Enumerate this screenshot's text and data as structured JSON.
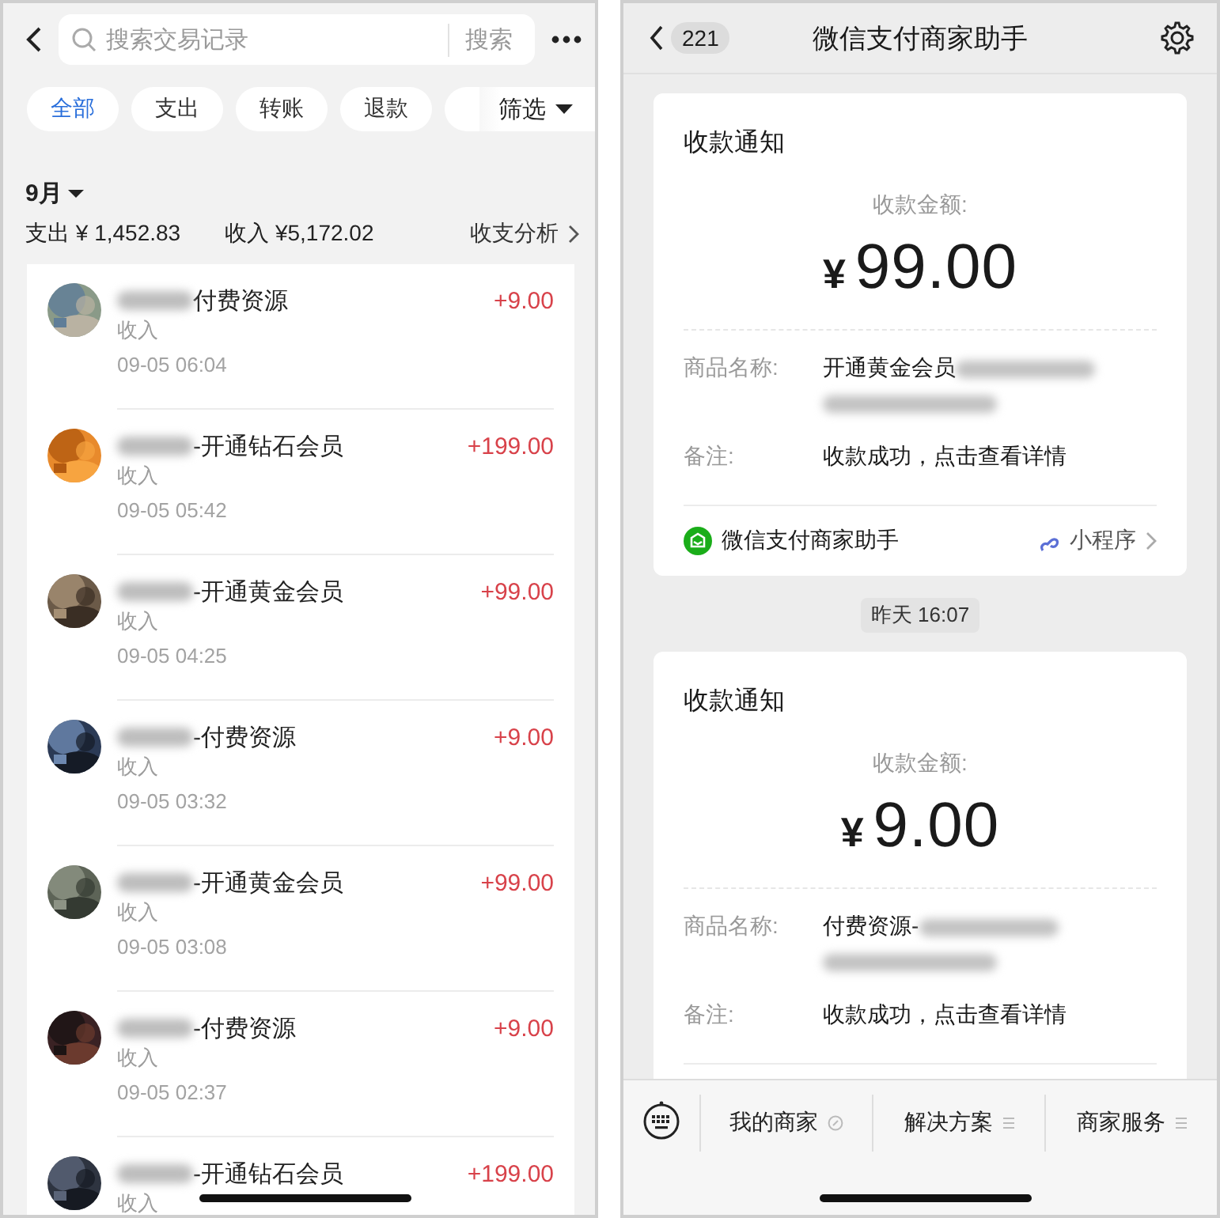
{
  "ledger": {
    "search": {
      "placeholder": "搜索交易记录",
      "button": "搜索"
    },
    "filters": [
      {
        "label": "全部",
        "selected": true
      },
      {
        "label": "支出",
        "selected": false
      },
      {
        "label": "转账",
        "selected": false
      },
      {
        "label": "退款",
        "selected": false
      }
    ],
    "filter_button": "筛选",
    "month": "9月",
    "expense": "支出 ¥ 1,452.83",
    "income": "收入 ¥5,172.02",
    "analysis": "收支分析",
    "transactions": [
      {
        "title": "付费资源",
        "redacted": true,
        "amount": "+9.00",
        "type": "收入",
        "time": "09-05 06:04"
      },
      {
        "title": "-开通钻石会员",
        "redacted": true,
        "amount": "+199.00",
        "type": "收入",
        "time": "09-05 05:42"
      },
      {
        "title": "-开通黄金会员",
        "redacted": true,
        "amount": "+99.00",
        "type": "收入",
        "time": "09-05 04:25"
      },
      {
        "title": "-付费资源",
        "redacted": true,
        "amount": "+9.00",
        "type": "收入",
        "time": "09-05 03:32"
      },
      {
        "title": "-开通黄金会员",
        "redacted": true,
        "amount": "+99.00",
        "type": "收入",
        "time": "09-05 03:08"
      },
      {
        "title": "-付费资源",
        "redacted": true,
        "amount": "+9.00",
        "type": "收入",
        "time": "09-05 02:37"
      },
      {
        "title": "-开通钻石会员",
        "redacted": true,
        "amount": "+199.00",
        "type": "收入"
      }
    ]
  },
  "chat": {
    "unread": "221",
    "title": "微信支付商家助手",
    "messages": [
      {
        "kind": "notice",
        "title": "收款通知",
        "amount_label": "收款金额:",
        "currency": "¥",
        "amount": "99.00",
        "fields": [
          {
            "label": "商品名称:",
            "value": "开通黄金会员",
            "redacted": true
          },
          {
            "label": "备注:",
            "value": "收款成功，点击查看详情",
            "redacted": false
          }
        ],
        "source": "微信支付商家助手",
        "source_tag": "小程序"
      },
      {
        "kind": "time",
        "text": "昨天 16:07"
      },
      {
        "kind": "notice",
        "title": "收款通知",
        "amount_label": "收款金额:",
        "currency": "¥",
        "amount": "9.00",
        "fields": [
          {
            "label": "商品名称:",
            "value": "付费资源-",
            "redacted": true
          },
          {
            "label": "备注:",
            "value": "收款成功，点击查看详情",
            "redacted": false
          }
        ]
      }
    ],
    "menu": [
      "我的商家",
      "解决方案",
      "商家服务"
    ]
  }
}
